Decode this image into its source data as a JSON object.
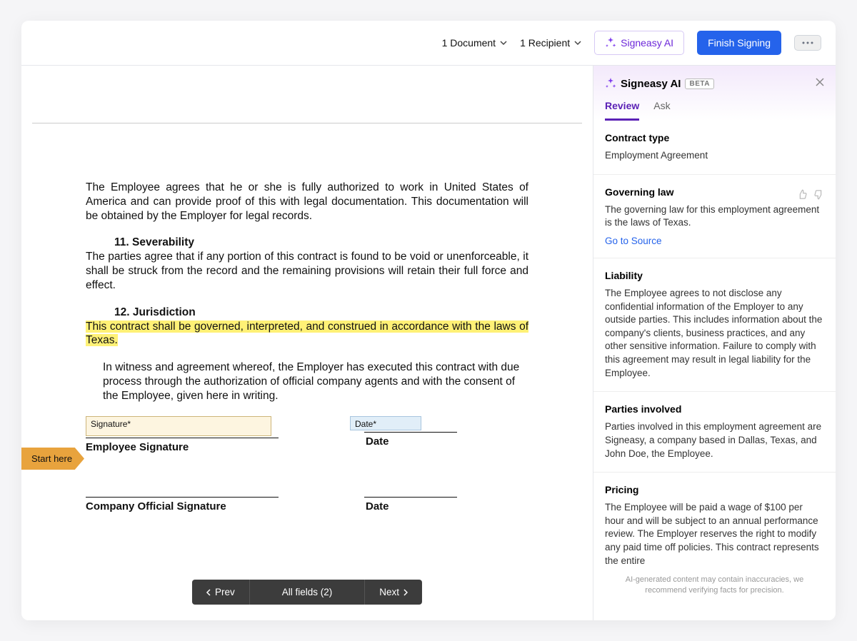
{
  "header": {
    "doc_count": "1 Document",
    "recipient_count": "1 Recipient",
    "ai_button": "Signeasy AI",
    "finish_button": "Finish Signing"
  },
  "document": {
    "auth_para": "The Employee agrees that he or she is fully authorized to work in United States of America and can provide proof of this with legal documentation. This documentation will be obtained by the Employer for legal records.",
    "sev_title": "11. Severability",
    "sev_text": "The parties agree that if any portion of this contract is found to be void or unenforceable, it shall be struck from the record and the remaining provisions will retain their full force and effect.",
    "jur_title": "12. Jurisdiction",
    "jur_highlight": "This contract shall be governed, interpreted, and construed in accordance with the laws of Texas.",
    "witness_para": "In witness and agreement whereof, the Employer has executed this contract with due process through the authorization of official company agents and with the consent of the Employee, given here in writing.",
    "sig_ph": "Signature*",
    "date_ph": "Date*",
    "emp_sig_label": "Employee Signature",
    "date_label": "Date",
    "company_sig_label": "Company Official Signature",
    "start_here": "Start here"
  },
  "nav": {
    "prev": "Prev",
    "all_fields": "All fields (2)",
    "next": "Next"
  },
  "ai": {
    "panel_title": "Signeasy AI",
    "beta": "BETA",
    "tabs": {
      "review": "Review",
      "ask": "Ask"
    },
    "contract_type": {
      "title": "Contract type",
      "value": "Employment Agreement"
    },
    "governing_law": {
      "title": "Governing law",
      "text": "The governing law for this employment agreement is the laws of Texas.",
      "link": "Go to Source"
    },
    "liability": {
      "title": "Liability",
      "text": "The Employee agrees to not disclose any confidential information of the Employer to any outside parties. This includes information about the company's clients, business practices, and any other sensitive information. Failure to comply with this agreement may result in legal liability for the Employee."
    },
    "parties": {
      "title": "Parties involved",
      "text": "Parties involved in this employment agreement are Signeasy, a company based in Dallas, Texas, and John Doe, the Employee."
    },
    "pricing": {
      "title": "Pricing",
      "text": "The Employee will be paid a wage of $100 per hour and will be subject to an annual performance review. The Employer reserves the right to modify any paid time off policies. This contract represents the entire"
    },
    "disclaimer": "AI-generated content may contain inaccuracies, we recommend verifying facts for precision."
  }
}
